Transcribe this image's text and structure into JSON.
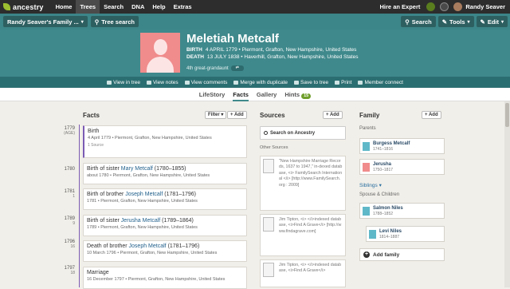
{
  "topbar": {
    "logo": "ancestry",
    "nav": [
      "Home",
      "Trees",
      "Search",
      "DNA",
      "Help",
      "Extras"
    ],
    "active_nav": "Trees",
    "hire": "Hire an Expert",
    "username": "Randy Seaver"
  },
  "subbar": {
    "tree_name": "Randy Seaver's Family ...",
    "tree_search": "Tree search",
    "search": "Search",
    "tools": "Tools",
    "edit": "Edit"
  },
  "person": {
    "name": "Meletiah Metcalf",
    "birth_label": "BIRTH",
    "birth": "4 APRIL 1779 • Piermont, Grafton, New Hampshire, United States",
    "death_label": "DEATH",
    "death": "13 JULY 1838 • Haverhill, Grafton, New Hampshire, United States",
    "relation": "4th great-grandaunt"
  },
  "actions": [
    "View in tree",
    "View notes",
    "View comments",
    "Merge with duplicate",
    "Save to tree",
    "Print",
    "Member connect"
  ],
  "tabs": {
    "items": [
      "LifeStory",
      "Facts",
      "Gallery",
      "Hints"
    ],
    "active": "Facts",
    "hints_count": "15"
  },
  "facts": {
    "heading": "Facts",
    "filter_btn": "Filter",
    "add_btn": "+ Add",
    "items": [
      {
        "year": "1779",
        "age": "(AGE)",
        "title": "Birth",
        "link": "",
        "title_end": "",
        "detail": "4 April 1779 • Piermont, Grafton, New Hampshire, United States",
        "sources": "1 Source"
      },
      {
        "year": "1780",
        "age": "",
        "title": "Birth of sister ",
        "link": "Mary Metcalf",
        "title_end": " (1780–1855)",
        "detail": "about 1780 • Piermont, Grafton, New Hampshire, United States",
        "sources": ""
      },
      {
        "year": "1781",
        "age": "1",
        "title": "Birth of brother ",
        "link": "Joseph Metcalf",
        "title_end": " (1781–1796)",
        "detail": "1781 • Piermont, Grafton, New Hampshire, United States",
        "sources": ""
      },
      {
        "year": "1789",
        "age": "9",
        "title": "Birth of sister ",
        "link": "Jerusha Metcalf",
        "title_end": " (1789–1864)",
        "detail": "1789 • Piermont, Grafton, New Hampshire, United States",
        "sources": ""
      },
      {
        "year": "1796",
        "age": "16",
        "title": "Death of brother ",
        "link": "Joseph Metcalf",
        "title_end": " (1781–1796)",
        "detail": "10 March 1796 • Piermont, Grafton, New Hampshire, United States",
        "sources": ""
      },
      {
        "year": "1797",
        "age": "18",
        "title": "Marriage",
        "link": "",
        "title_end": "",
        "detail": "16 December 1797 • Piermont, Grafton, New Hampshire, United States",
        "sources": ""
      }
    ]
  },
  "sources": {
    "heading": "Sources",
    "add_btn": "+ Add",
    "search_btn": "Search on Ancestry",
    "other_label": "Other Sources",
    "items": [
      "\"New Hampshire Marriage Records, 1637 to 1947,\" in-dexed database, <i> FamilySearch International </i> [http://www.FamilySearch.org : 2009]",
      "Jim Tipton, <i> </i>indexed database, <i>Find A Grave</i> [http://www.findagrave.com]",
      "Jim Tipton, <i> </i>indexed database, <i>Find A Grave</i>"
    ]
  },
  "family": {
    "heading": "Family",
    "add_btn": "+ Add",
    "parents_label": "Parents",
    "parents": [
      {
        "name": "Burgess Metcalf",
        "dates": "1741–1816",
        "sex": "m"
      },
      {
        "name": "Jerusha",
        "dates": "1750–1817",
        "sex": "f"
      }
    ],
    "siblings": "Siblings",
    "spouse_label": "Spouse & Children",
    "spouse": {
      "name": "Salmon Niles",
      "dates": "1788–1852",
      "sex": "m"
    },
    "child": {
      "name": "Levi Niles",
      "dates": "1814–1887",
      "sex": "m"
    },
    "add_family": "Add family"
  }
}
